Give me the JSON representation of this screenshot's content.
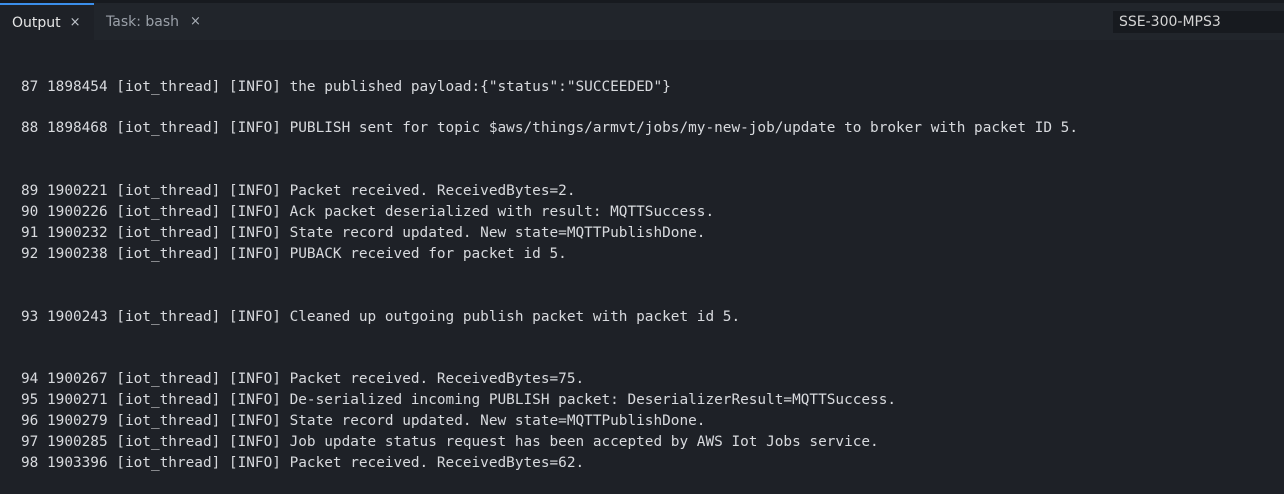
{
  "tabs": {
    "output_label": "Output",
    "task_label": "Task: bash",
    "close_glyph": "×"
  },
  "target_dropdown": {
    "selected": "SSE-300-MPS3"
  },
  "log_lines": [
    "87 1898454 [iot_thread] [INFO] the published payload:{\"status\":\"SUCCEEDED\"}",
    "88 1898468 [iot_thread] [INFO] PUBLISH sent for topic $aws/things/armvt/jobs/my-new-job/update to broker with packet ID 5.",
    "89 1900221 [iot_thread] [INFO] Packet received. ReceivedBytes=2.",
    "90 1900226 [iot_thread] [INFO] Ack packet deserialized with result: MQTTSuccess.",
    "91 1900232 [iot_thread] [INFO] State record updated. New state=MQTTPublishDone.",
    "92 1900238 [iot_thread] [INFO] PUBACK received for packet id 5.",
    "93 1900243 [iot_thread] [INFO] Cleaned up outgoing publish packet with packet id 5.",
    "94 1900267 [iot_thread] [INFO] Packet received. ReceivedBytes=75.",
    "95 1900271 [iot_thread] [INFO] De-serialized incoming PUBLISH packet: DeserializerResult=MQTTSuccess.",
    "96 1900279 [iot_thread] [INFO] State record updated. New state=MQTTPublishDone.",
    "97 1900285 [iot_thread] [INFO] Job update status request has been accepted by AWS Iot Jobs service.",
    "98 1903396 [iot_thread] [INFO] Packet received. ReceivedBytes=62."
  ]
}
